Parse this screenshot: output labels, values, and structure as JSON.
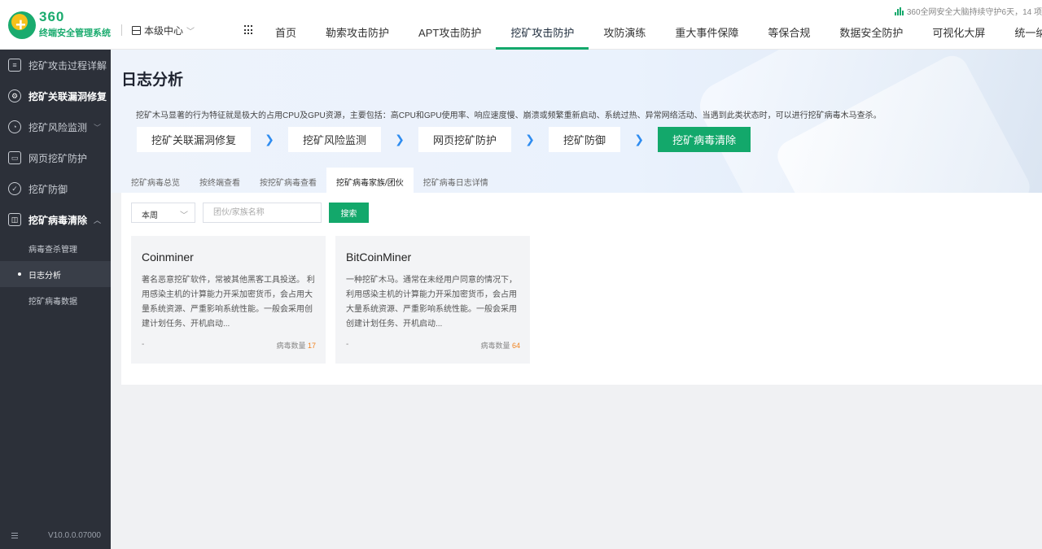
{
  "app": {
    "logo_text": "360",
    "logo_subtitle": "终端安全管理系统",
    "center_label": "本级中心",
    "status_text": "360全网安全大脑持续守护6天，14 项"
  },
  "nav": [
    "首页",
    "勒索攻击防护",
    "APT攻击防护",
    "挖矿攻击防护",
    "攻防演练",
    "重大事件保障",
    "等保合规",
    "数据安全防护",
    "可视化大屏",
    "统一纳"
  ],
  "nav_active": "挖矿攻击防护",
  "sidebar": {
    "items": [
      {
        "label": "挖矿攻击过程详解",
        "icon": "document-list-icon"
      },
      {
        "label": "挖矿关联漏洞修复",
        "icon": "shield-gear-icon"
      },
      {
        "label": "挖矿风险监测",
        "icon": "radar-icon"
      },
      {
        "label": "网页挖矿防护",
        "icon": "webpage-icon"
      },
      {
        "label": "挖矿防御",
        "icon": "shield-icon"
      },
      {
        "label": "挖矿病毒清除",
        "icon": "virus-clean-icon"
      }
    ],
    "sub_items": [
      "病毒查杀管理",
      "日志分析",
      "挖矿病毒数据"
    ],
    "version": "V10.0.0.07000"
  },
  "page": {
    "title": "日志分析",
    "description": "挖矿木马显著的行为特征就是极大的占用CPU及GPU资源，主要包括：高CPU和GPU使用率、响应速度慢、崩溃或频繁重新启动、系统过热、异常网络活动、当遇到此类状态时，可以进行挖矿病毒木马查杀。",
    "steps": [
      "挖矿关联漏洞修复",
      "挖矿风险监测",
      "网页挖矿防护",
      "挖矿防御",
      "挖矿病毒清除"
    ],
    "step_arrow": "❯",
    "tabs": [
      "挖矿病毒总览",
      "按终端查看",
      "按挖矿病毒查看",
      "挖矿病毒家族/团伙",
      "挖矿病毒日志详情"
    ]
  },
  "filter": {
    "period": "本周",
    "placeholder": "团伙/家族名称",
    "search_label": "搜索"
  },
  "cards": [
    {
      "title": "Coinminer",
      "description": "著名恶意挖矿软件，常被其他黑客工具投送。 利用感染主机的计算能力开采加密货币，会占用大量系统资源、严重影响系统性能。一般会采用创建计划任务、开机启动...",
      "tag": "-",
      "count_label": "病毒数量",
      "count": "17"
    },
    {
      "title": "BitCoinMiner",
      "description": "一种挖矿木马。通常在未经用户同意的情况下，利用感染主机的计算能力开采加密货币，会占用大量系统资源、严重影响系统性能。一般会采用创建计划任务、开机启动...",
      "tag": "-",
      "count_label": "病毒数量",
      "count": "64"
    }
  ],
  "colors": {
    "accent": "#13a86b",
    "sidebar_bg": "#2c3039",
    "count_highlight": "#f0821e",
    "step_arrow": "#2e8cf0"
  }
}
